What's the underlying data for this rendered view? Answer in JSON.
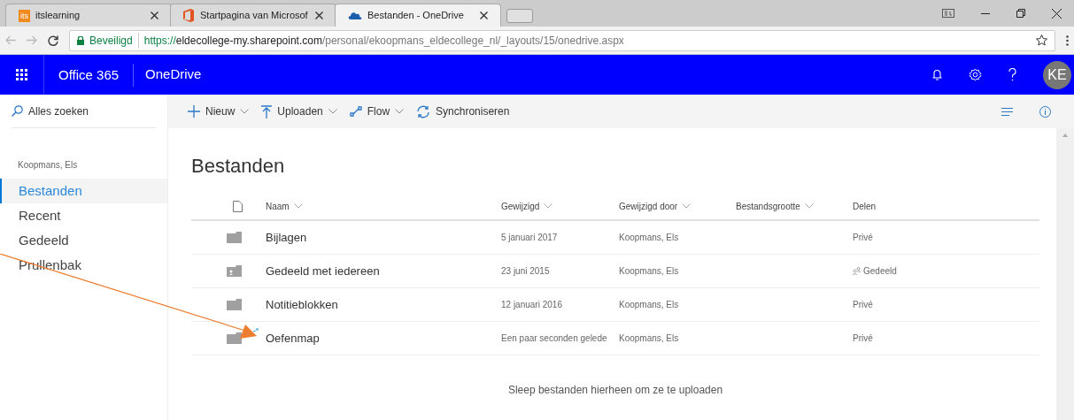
{
  "browser": {
    "tabs": [
      {
        "title": "itslearning",
        "icon_text": "its",
        "selected": false
      },
      {
        "title": "Startpagina van Microsof",
        "selected": false
      },
      {
        "title": "Bestanden - OneDrive",
        "selected": true
      }
    ],
    "secure_label": "Beveiligd",
    "url_host": "https://eldecollege-my.sharepoint.com",
    "url_path": "/personal/ekoopmans_eldecollege_nl/_layouts/15/onedrive.aspx"
  },
  "suite_bar": {
    "app_name": "Office 365",
    "product": "OneDrive",
    "avatar": "KE"
  },
  "search": {
    "placeholder": "Alles zoeken"
  },
  "sidebar": {
    "user": "Koopmans, Els",
    "items": [
      {
        "label": "Bestanden",
        "selected": true
      },
      {
        "label": "Recent",
        "selected": false
      },
      {
        "label": "Gedeeld",
        "selected": false
      },
      {
        "label": "Prullenbak",
        "selected": false
      }
    ]
  },
  "toolbar": [
    {
      "label": "Nieuw",
      "dropdown": true
    },
    {
      "label": "Uploaden",
      "dropdown": true
    },
    {
      "label": "Flow",
      "dropdown": true
    },
    {
      "label": "Synchroniseren",
      "dropdown": false
    }
  ],
  "page_title": "Bestanden",
  "table": {
    "columns": [
      {
        "label": "Naam",
        "sortable": true
      },
      {
        "label": "Gewijzigd",
        "sortable": true
      },
      {
        "label": "Gewijzigd door",
        "sortable": true
      },
      {
        "label": "Bestandsgrootte",
        "sortable": true
      },
      {
        "label": "Delen",
        "sortable": false
      }
    ],
    "rows": [
      {
        "kind": "folder",
        "name": "Bijlagen",
        "modified": "5 januari 2017",
        "modified_by": "Koopmans, Els",
        "sharing": "Privé",
        "shared": false,
        "new": false
      },
      {
        "kind": "shared-folder",
        "name": "Gedeeld met iedereen",
        "modified": "23 juni 2015",
        "modified_by": "Koopmans, Els",
        "sharing": "Gedeeld",
        "shared": true,
        "new": false
      },
      {
        "kind": "folder",
        "name": "Notitieblokken",
        "modified": "12 januari 2016",
        "modified_by": "Koopmans, Els",
        "sharing": "Privé",
        "shared": false,
        "new": false
      },
      {
        "kind": "folder",
        "name": "Oefenmap",
        "modified": "Een paar seconden gelede",
        "modified_by": "Koopmans, Els",
        "sharing": "Privé",
        "shared": false,
        "new": true
      }
    ]
  },
  "drop_hint": "Sleep bestanden hierheen om ze te uploaden"
}
